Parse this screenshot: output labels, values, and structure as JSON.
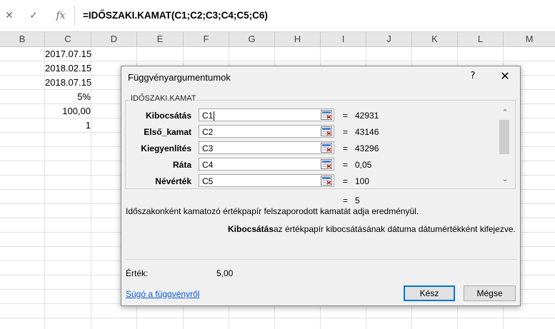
{
  "formula_bar": {
    "cancel_icon": "✕",
    "enter_icon": "✓",
    "fx_icon": "fx",
    "formula": "=IDŐSZAKI.KAMAT(C1;C2;C3;C4;C5;C6)"
  },
  "columns": [
    "B",
    "C",
    "D",
    "E",
    "F",
    "G",
    "H",
    "I",
    "J",
    "K",
    "L",
    "M"
  ],
  "cells_c": [
    "2017.07.15",
    "2018.02.15",
    "2018.07.15",
    "5%",
    "100,00",
    "1"
  ],
  "dialog": {
    "title": "Függvényargumentumok",
    "help_glyph": "?",
    "close_glyph": "✕",
    "function_name": "IDŐSZAKI.KAMAT",
    "args": [
      {
        "label": "Kibocsátás",
        "ref": "C1",
        "value": "42931"
      },
      {
        "label": "Első_kamat",
        "ref": "C2",
        "value": "43146"
      },
      {
        "label": "Kiegyenlítés",
        "ref": "C3",
        "value": "43296"
      },
      {
        "label": "Ráta",
        "ref": "C4",
        "value": "0,05"
      },
      {
        "label": "Névérték",
        "ref": "C5",
        "value": "100"
      }
    ],
    "eq": "=",
    "result": "5",
    "description": "Időszakonként kamatozó értékpapír felszaporodott kamatát adja eredményül.",
    "arg_desc_name": "Kibocsátás",
    "arg_desc_text": "az értékpapír kibocsátásának dátuma dátumértékként kifejezve.",
    "value_label": "Érték:",
    "value": "5,00",
    "help_link": "Súgó a függvényről",
    "ok_label": "Kész",
    "cancel_label": "Mégse"
  }
}
